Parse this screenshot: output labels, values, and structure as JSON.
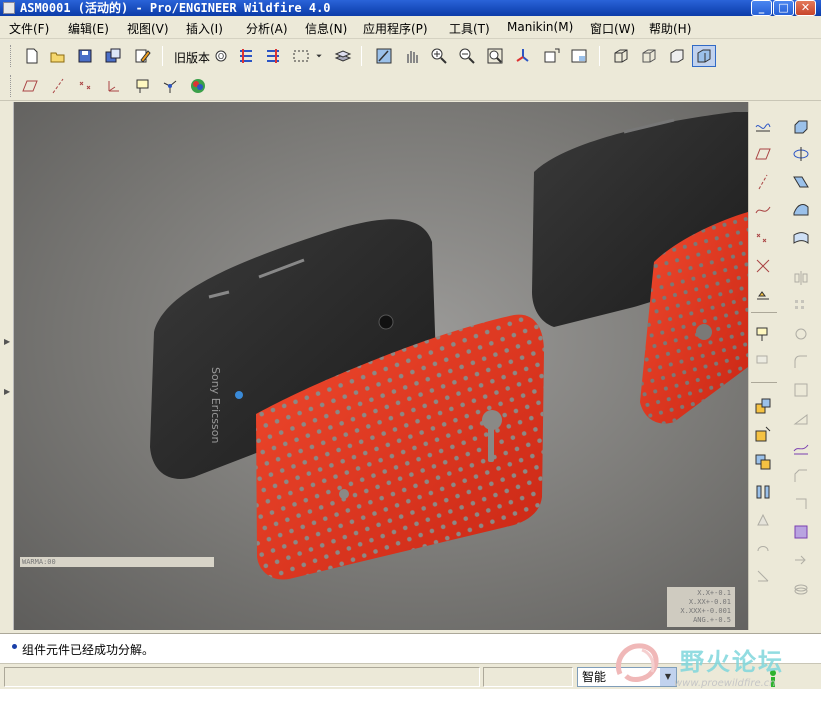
{
  "window": {
    "title": "ASM0001 (活动的) - Pro/ENGINEER Wildfire 4.0",
    "minimize_label": "_",
    "maximize_label": "□",
    "close_label": "✕"
  },
  "menu": {
    "items": [
      {
        "label": "文件(F)"
      },
      {
        "label": "编辑(E)"
      },
      {
        "label": "视图(V)"
      },
      {
        "label": "插入(I)"
      },
      {
        "label": "分析(A)"
      },
      {
        "label": "信息(N)"
      },
      {
        "label": "应用程序(P)"
      },
      {
        "label": "工具(T)"
      },
      {
        "label": "Manikin(M)"
      },
      {
        "label": "窗口(W)"
      },
      {
        "label": "帮助(H)"
      }
    ]
  },
  "toolbar": {
    "old_version_label": "旧版本",
    "icons_row1": [
      "new-file-icon",
      "open-file-icon",
      "save-icon",
      "save-copy-icon",
      "edit-icon",
      "old-version-icon",
      "regenerate-icon",
      "regenerate-manager-icon",
      "select-box-icon",
      "layers-icon",
      "repaint-icon",
      "pan-icon",
      "zoom-in-icon",
      "zoom-out-icon",
      "zoom-fit-icon",
      "orient-icon",
      "saved-views-icon",
      "view-manager-icon",
      "wireframe-icon",
      "hidden-line-icon",
      "no-hidden-icon",
      "shading-icon"
    ],
    "icons_row2": [
      "datum-plane-display-icon",
      "datum-axis-display-icon",
      "point-display-icon",
      "csys-display-icon",
      "annotation-display-icon",
      "spin-center-icon",
      "appearance-icon"
    ]
  },
  "viewport": {
    "scale_text": "WARMA:00",
    "tolerance_lines": [
      "X.X+-0.1",
      "X.XX+-0.01",
      "X.XXX+-0.001",
      "ANG.+-0.5"
    ],
    "phone_brand": "Sony Ericsson",
    "accent_red": "#e8371f",
    "phone_black": "#2a2a2a"
  },
  "right_toolbar": {
    "icons": [
      "sketch-tool-icon",
      "datum-plane-icon",
      "datum-axis-icon",
      "datum-curve-icon",
      "datum-point-icon",
      "datum-csys-icon",
      "analysis-icon",
      "assemble-icon",
      "create-component-icon",
      "package-icon",
      "explode-icon",
      "mirror-icon",
      "repeat-icon",
      "flip-icon",
      "pattern-icon"
    ]
  },
  "status": {
    "message": "组件元件已经成功分解。",
    "filter_value": "智能",
    "traffic_color": "#2db32d"
  },
  "watermark": {
    "text": "野火论坛",
    "url": "www.proewildfire.cn"
  }
}
